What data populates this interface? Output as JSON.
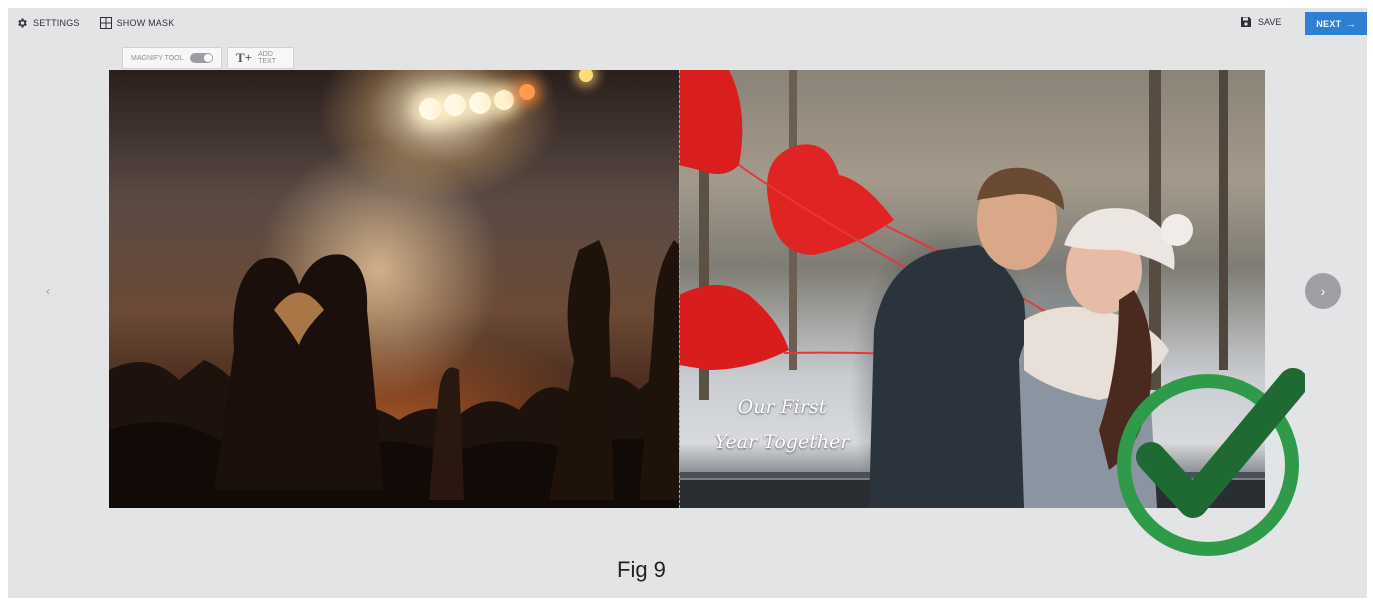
{
  "toolbar": {
    "settings_label": "SETTINGS",
    "show_mask_label": "SHOW MASK",
    "save_label": "SAVE",
    "next_label": "NEXT"
  },
  "tools": {
    "magnify_label": "MAGNIFY TOOL",
    "magnify_enabled": false,
    "add_text_label": "ADD TEXT"
  },
  "spread": {
    "left_page_image": "concert crowd making heart hands under stage lights",
    "right_page_image": "couple embracing with red heart balloons in winter park",
    "caption_lines": [
      "Our First",
      "Year Together"
    ]
  },
  "navigation": {
    "prev_icon": "chevron-left-icon",
    "next_icon": "chevron-right-icon"
  },
  "overlay": {
    "checkmark_icon": "check-circle-icon",
    "checkmark_color": "#2e9a4a",
    "checkmark_dark": "#1f6a33"
  },
  "figure_label": "Fig 9",
  "colors": {
    "accent": "#2f7fd4",
    "background": "#e3e4e6"
  }
}
